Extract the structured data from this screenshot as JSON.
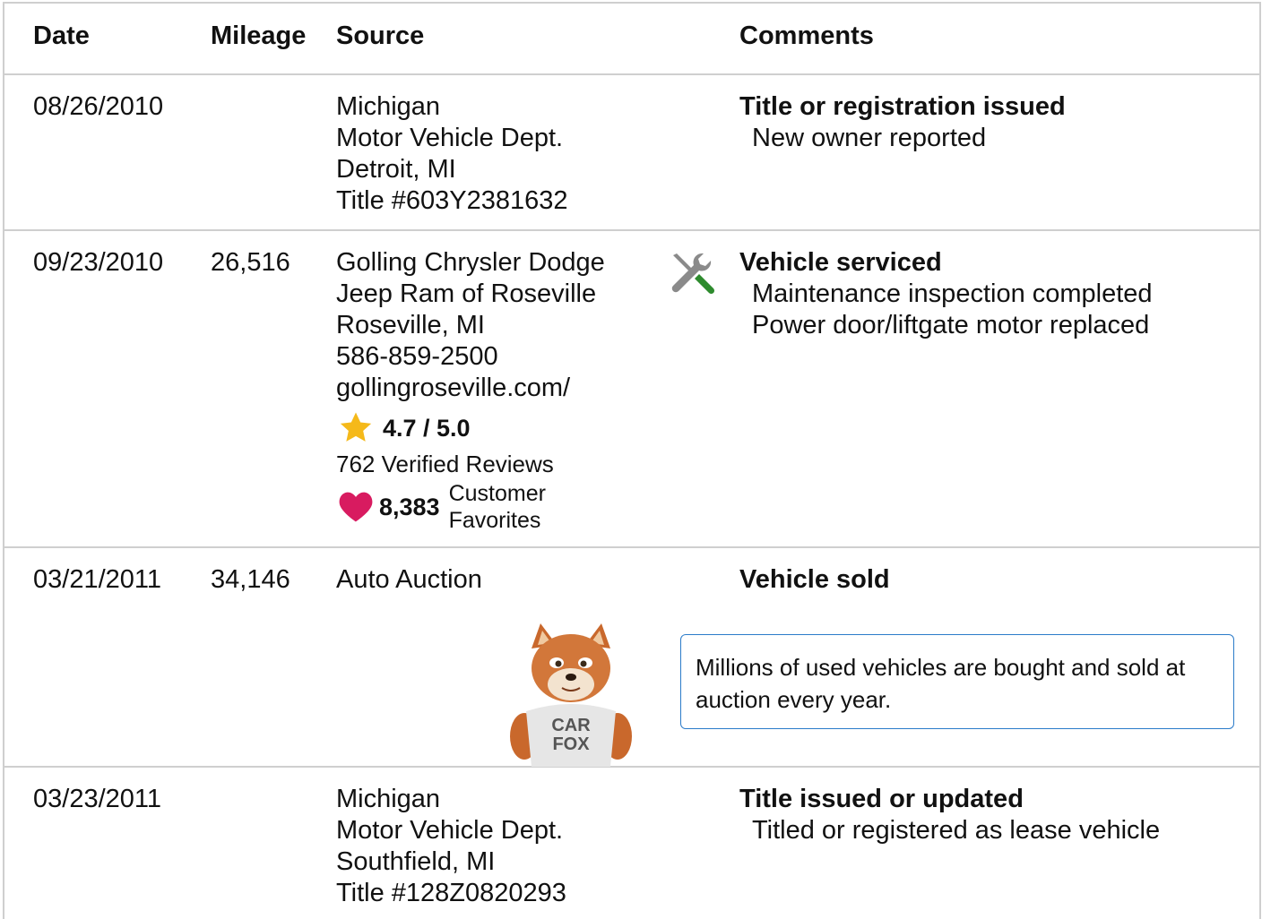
{
  "header": {
    "date": "Date",
    "mileage": "Mileage",
    "source": "Source",
    "comments": "Comments"
  },
  "rows": [
    {
      "date": "08/26/2010",
      "mileage": "",
      "source": [
        "Michigan",
        "Motor Vehicle Dept.",
        "Detroit, MI",
        "Title #603Y2381632"
      ],
      "comment_title": "Title or registration issued",
      "comment_details": [
        "New owner reported"
      ]
    },
    {
      "date": "09/23/2010",
      "mileage": "26,516",
      "source": [
        "Golling Chrysler Dodge",
        "Jeep Ram of Roseville",
        "Roseville, MI",
        "586-859-2500",
        "gollingroseville.com/"
      ],
      "rating": "4.7 / 5.0",
      "reviews": "762 Verified Reviews",
      "favorites_count": "8,383",
      "favorites_label": "Customer Favorites",
      "comment_icon": "wrench-screwdriver-icon",
      "comment_title": "Vehicle serviced",
      "comment_details": [
        "Maintenance inspection completed",
        "Power door/liftgate motor replaced"
      ]
    },
    {
      "date": "03/21/2011",
      "mileage": "34,146",
      "source": [
        "Auto Auction"
      ],
      "comment_title": "Vehicle sold",
      "callout": "Millions of used vehicles are bought and sold at auction every year.",
      "mascot_shirt": "CAR FOX"
    },
    {
      "date": "03/23/2011",
      "mileage": "",
      "source": [
        "Michigan",
        "Motor Vehicle Dept.",
        "Southfield, MI",
        "Title #128Z0820293"
      ],
      "comment_title": "Title issued or updated",
      "comment_details": [
        "Titled or registered as lease vehicle"
      ]
    }
  ],
  "colors": {
    "border": "#cfcfcf",
    "star": "#f5b91a",
    "heart": "#d81b60",
    "callout_border": "#2b7bc9",
    "screwdriver_handle": "#2e8b2e"
  }
}
